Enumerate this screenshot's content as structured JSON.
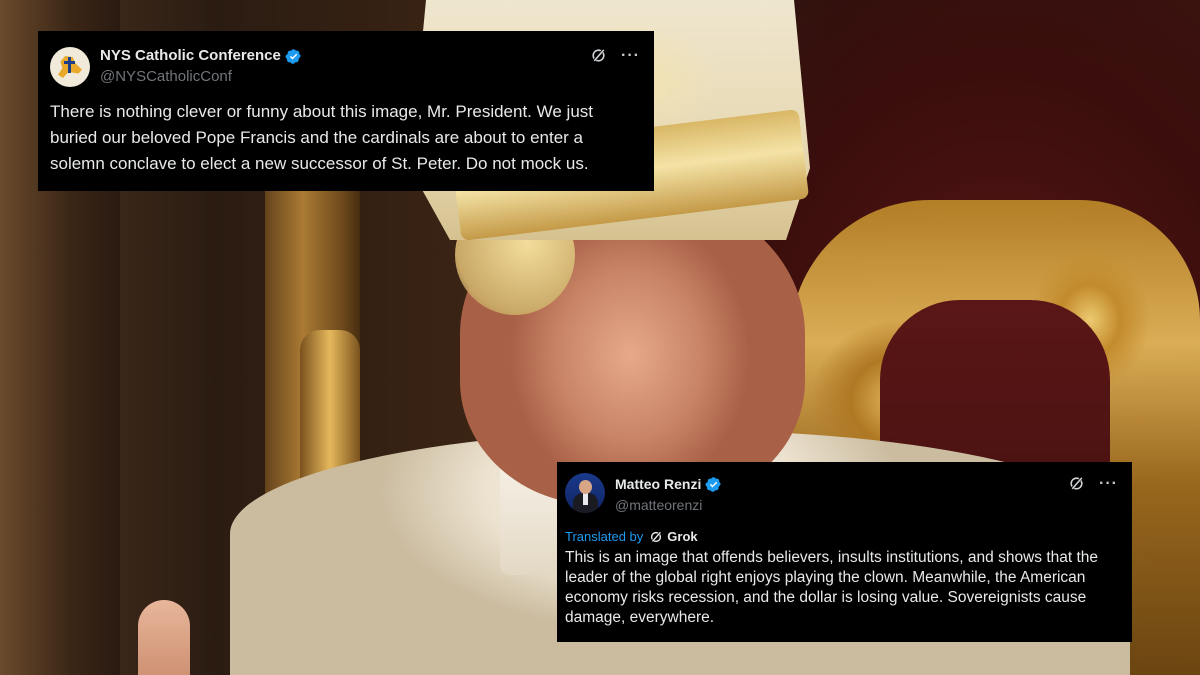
{
  "tweets": [
    {
      "display_name": "NYS Catholic Conference",
      "handle": "@NYSCatholicConf",
      "verified": true,
      "avatar_icon": "nys-catholic-logo",
      "text": "There is nothing clever or funny about this image, Mr. President. We just buried our beloved Pope Francis and the cardinals are about to enter a solemn conclave to elect a new successor of St. Peter. Do not mock us."
    },
    {
      "display_name": "Matteo Renzi",
      "handle": "@matteorenzi",
      "verified": true,
      "avatar_icon": "profile-photo",
      "translated_label": "Translated by",
      "translator_name": "Grok",
      "text": "This is an image that offends believers, insults institutions, and shows that the leader of the global right enjoys playing the clown. Meanwhile, the American economy risks recession, and the dollar is losing value. Sovereignists cause damage, everywhere."
    }
  ],
  "icons": {
    "verified": "verified-badge-icon",
    "grok": "grok-icon",
    "more": "more-options-icon"
  },
  "colors": {
    "card_bg": "#000000",
    "text": "#e7e9ea",
    "handle": "#71767b",
    "accent": "#1d9bf0"
  }
}
